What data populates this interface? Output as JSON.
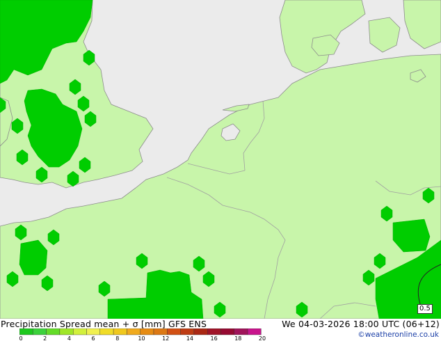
{
  "title": "Precipitation Spread mean + σ [mm] GFS ENS",
  "datetime": "We 04-03-2026 18:00 UTC (06+12)",
  "credit": "©weatheronline.co.uk",
  "contour_label": "0.5",
  "colors": {
    "sea": "#ebebeb",
    "land_light": "#c8f5aa",
    "precip_green": "#00cd00",
    "border": "#a0a0a0",
    "coast": "#8c8c8c"
  },
  "legend": {
    "colors": [
      "#1ec81e",
      "#3cd23c",
      "#64dc28",
      "#a0e628",
      "#d2f03c",
      "#f0f050",
      "#f0dc28",
      "#f0c81e",
      "#f0aa1e",
      "#e68c14",
      "#dc7814",
      "#d25014",
      "#be3c14",
      "#aa2814",
      "#a01428",
      "#960a32",
      "#a0145a",
      "#c8148c"
    ],
    "tick_labels": [
      "0",
      "2",
      "4",
      "6",
      "8",
      "10",
      "12",
      "14",
      "16",
      "18",
      "20"
    ]
  }
}
